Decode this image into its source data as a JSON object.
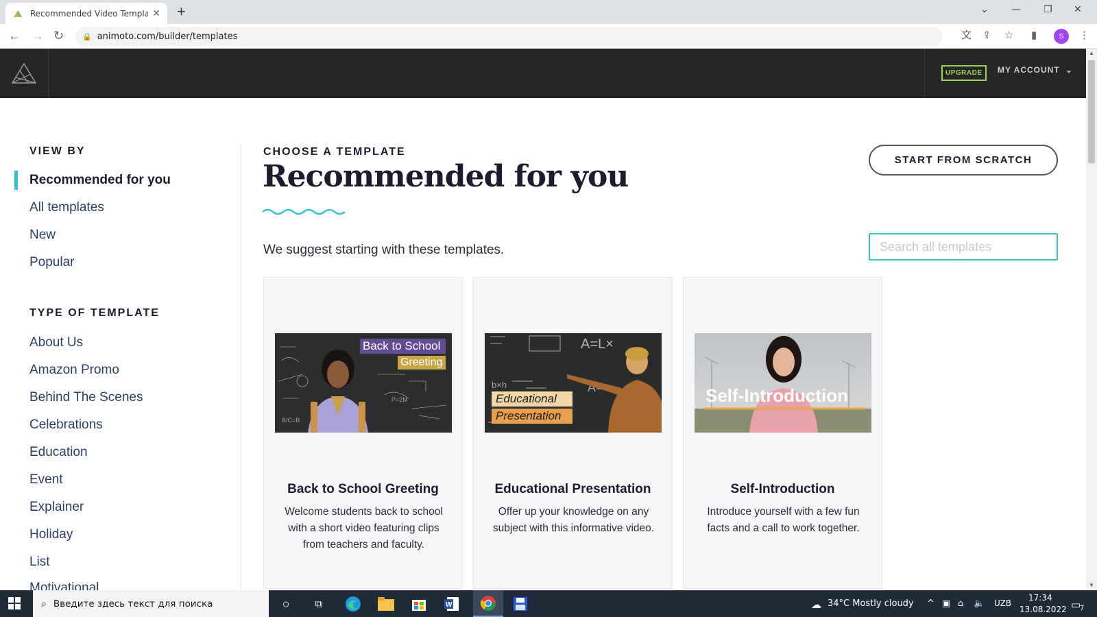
{
  "browser": {
    "tab_title": "Recommended Video Templates",
    "url": "animoto.com/builder/templates",
    "profile_initial": "S"
  },
  "header": {
    "upgrade_label": "UPGRADE",
    "account_label": "MY ACCOUNT"
  },
  "sidebar": {
    "view_by_heading": "VIEW BY",
    "view_by_items": [
      {
        "label": "Recommended for you",
        "active": true
      },
      {
        "label": "All templates"
      },
      {
        "label": "New"
      },
      {
        "label": "Popular"
      }
    ],
    "type_heading": "TYPE OF TEMPLATE",
    "type_items": [
      {
        "label": "About Us"
      },
      {
        "label": "Amazon Promo"
      },
      {
        "label": "Behind The Scenes"
      },
      {
        "label": "Celebrations"
      },
      {
        "label": "Education"
      },
      {
        "label": "Event"
      },
      {
        "label": "Explainer"
      },
      {
        "label": "Holiday"
      },
      {
        "label": "List"
      },
      {
        "label": "Motivational"
      }
    ]
  },
  "main": {
    "eyebrow": "CHOOSE A TEMPLATE",
    "title": "Recommended for you",
    "subtitle": "We suggest starting with these templates.",
    "scratch_label": "START FROM SCRATCH",
    "search_placeholder": "Search all templates"
  },
  "cards": [
    {
      "title": "Back to School Greeting",
      "description": "Welcome students back to school with a short video featuring clips from teachers and faculty.",
      "overlay_line1": "Back to School",
      "overlay_line2": "Greeting"
    },
    {
      "title": "Educational Presentation",
      "description": "Offer up your knowledge on any subject with this informative video.",
      "overlay_line1": "Educational",
      "overlay_line2": "Presentation"
    },
    {
      "title": "Self-Introduction",
      "description": "Introduce yourself with a few fun facts and a call to work together.",
      "overlay_line1": "Self-Introduction"
    }
  ],
  "taskbar": {
    "search_placeholder": "Введите здесь текст для поиска",
    "weather": "34°C  Mostly cloudy",
    "lang": "UZB",
    "time": "17:34",
    "date": "13.08.2022",
    "notifications": "7"
  },
  "colors": {
    "accent": "#37c2c9",
    "header_bg": "#262626",
    "upgrade": "#9bd14c",
    "title": "#1c1c2e"
  }
}
